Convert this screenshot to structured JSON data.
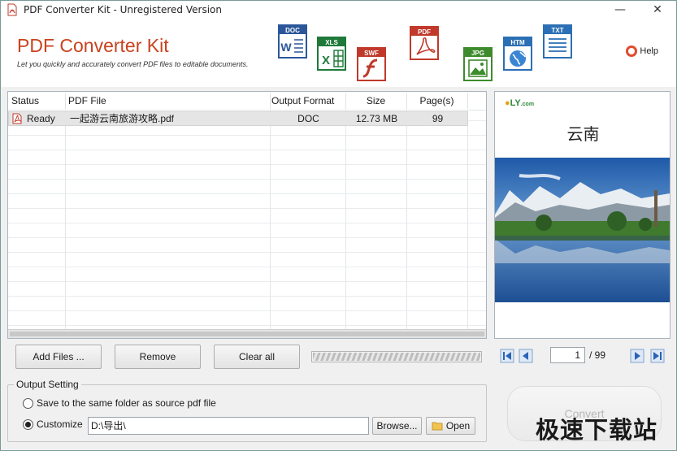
{
  "window": {
    "title": "PDF Converter Kit - Unregistered Version",
    "minimize_glyph": "—",
    "close_glyph": "✕"
  },
  "header": {
    "brand": "PDF Converter Kit",
    "tagline": "Let you quickly and accurately convert PDF files to editable documents.",
    "format_icons": [
      {
        "label": "DOC",
        "color": "#2b579a",
        "icon": "word-document-icon"
      },
      {
        "label": "XLS",
        "color": "#1f7a3a",
        "icon": "excel-sheet-icon"
      },
      {
        "label": "SWF",
        "color": "#c0392b",
        "icon": "flash-icon"
      },
      {
        "label": "PDF",
        "color": "#c0392b",
        "icon": "acrobat-icon"
      },
      {
        "label": "JPG",
        "color": "#3d8b2d",
        "icon": "image-icon"
      },
      {
        "label": "HTM",
        "color": "#2b6fb4",
        "icon": "globe-icon"
      },
      {
        "label": "TXT",
        "color": "#2b6fb4",
        "icon": "text-lines-icon"
      }
    ],
    "help_label": "Help"
  },
  "table": {
    "columns": [
      "Status",
      "PDF File",
      "Output Format",
      "Size",
      "Page(s)"
    ],
    "rows": [
      {
        "status": "Ready",
        "file": "一起游云南旅游攻略.pdf",
        "format": "DOC",
        "size": "12.73 MB",
        "pages": "99"
      }
    ]
  },
  "preview": {
    "logo_text": "LY",
    "logo_suffix": ".com",
    "doc_title": "云南"
  },
  "actions": {
    "add_files": "Add Files ...",
    "remove": "Remove",
    "clear_all": "Clear all"
  },
  "pager": {
    "current_page": "1",
    "total_pages": "/ 99"
  },
  "output_setting": {
    "legend": "Output Setting",
    "option_same_folder": "Save to the same folder as source pdf file",
    "option_customize": "Customize",
    "selected": "customize",
    "path": "D:\\导出\\",
    "browse": "Browse...",
    "open": "Open"
  },
  "convert": {
    "label": "Convert"
  },
  "watermark": {
    "text": "极速下载站"
  }
}
